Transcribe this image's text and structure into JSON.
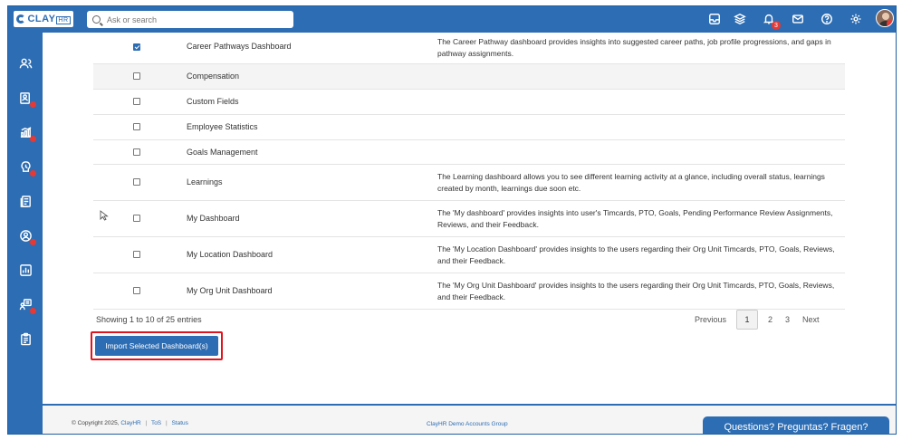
{
  "app": {
    "logo_text": "CLAY",
    "logo_suffix": "HR"
  },
  "search": {
    "placeholder": "Ask or search"
  },
  "topbar": {
    "icons": [
      "inbox-icon",
      "layers-icon",
      "bell-icon",
      "mail-icon",
      "help-icon",
      "gear-icon"
    ],
    "notification_count": "3"
  },
  "sidebar": {
    "items": [
      "people-icon",
      "badge-icon",
      "analytics-icon",
      "goals-icon",
      "documents-icon",
      "compensation-icon",
      "reports-icon",
      "learning-icon",
      "clipboard-icon"
    ]
  },
  "table": {
    "rows": [
      {
        "checked": true,
        "name": "Career Pathways Dashboard",
        "desc": "The Career Pathway dashboard provides insights into suggested career paths, job profile progressions, and gaps in pathway assignments."
      },
      {
        "checked": false,
        "name": "Compensation",
        "desc": ""
      },
      {
        "checked": false,
        "name": "Custom Fields",
        "desc": ""
      },
      {
        "checked": false,
        "name": "Employee Statistics",
        "desc": ""
      },
      {
        "checked": false,
        "name": "Goals Management",
        "desc": ""
      },
      {
        "checked": false,
        "name": "Learnings",
        "desc": "The Learning dashboard allows you to see different learning activity at a glance, including overall status, learnings created by month, learnings due soon etc."
      },
      {
        "checked": false,
        "name": "My Dashboard",
        "desc": "The 'My dashboard' provides insights into user's Timcards, PTO, Goals, Pending Performance Review Assignments, Reviews, and their Feedback."
      },
      {
        "checked": false,
        "name": "My Location Dashboard",
        "desc": "The 'My Location Dashboard' provides insights to the users regarding their Org Unit Timcards, PTO, Goals, Reviews, and their Feedback."
      },
      {
        "checked": false,
        "name": "My Org Unit Dashboard",
        "desc": "The 'My Org Unit Dashboard' provides insights to the users regarding their Org Unit Timcards, PTO, Goals, Reviews, and their Feedback."
      }
    ]
  },
  "pagination": {
    "showing": "Showing 1 to 10 of 25 entries",
    "previous": "Previous",
    "pages": [
      "1",
      "2",
      "3"
    ],
    "active_page": "1",
    "next": "Next"
  },
  "actions": {
    "import_label": "Import Selected Dashboard(s)"
  },
  "footer": {
    "copyright": "© Copyright 2025,",
    "brand": "ClayHR",
    "tos": "ToS",
    "status": "Status",
    "center": "ClayHR Demo Accounts Group",
    "help": "Questions? Preguntas? Fragen?"
  },
  "colors": {
    "primary": "#2d6db3",
    "alert": "#e53935",
    "highlight": "#e0141e"
  }
}
